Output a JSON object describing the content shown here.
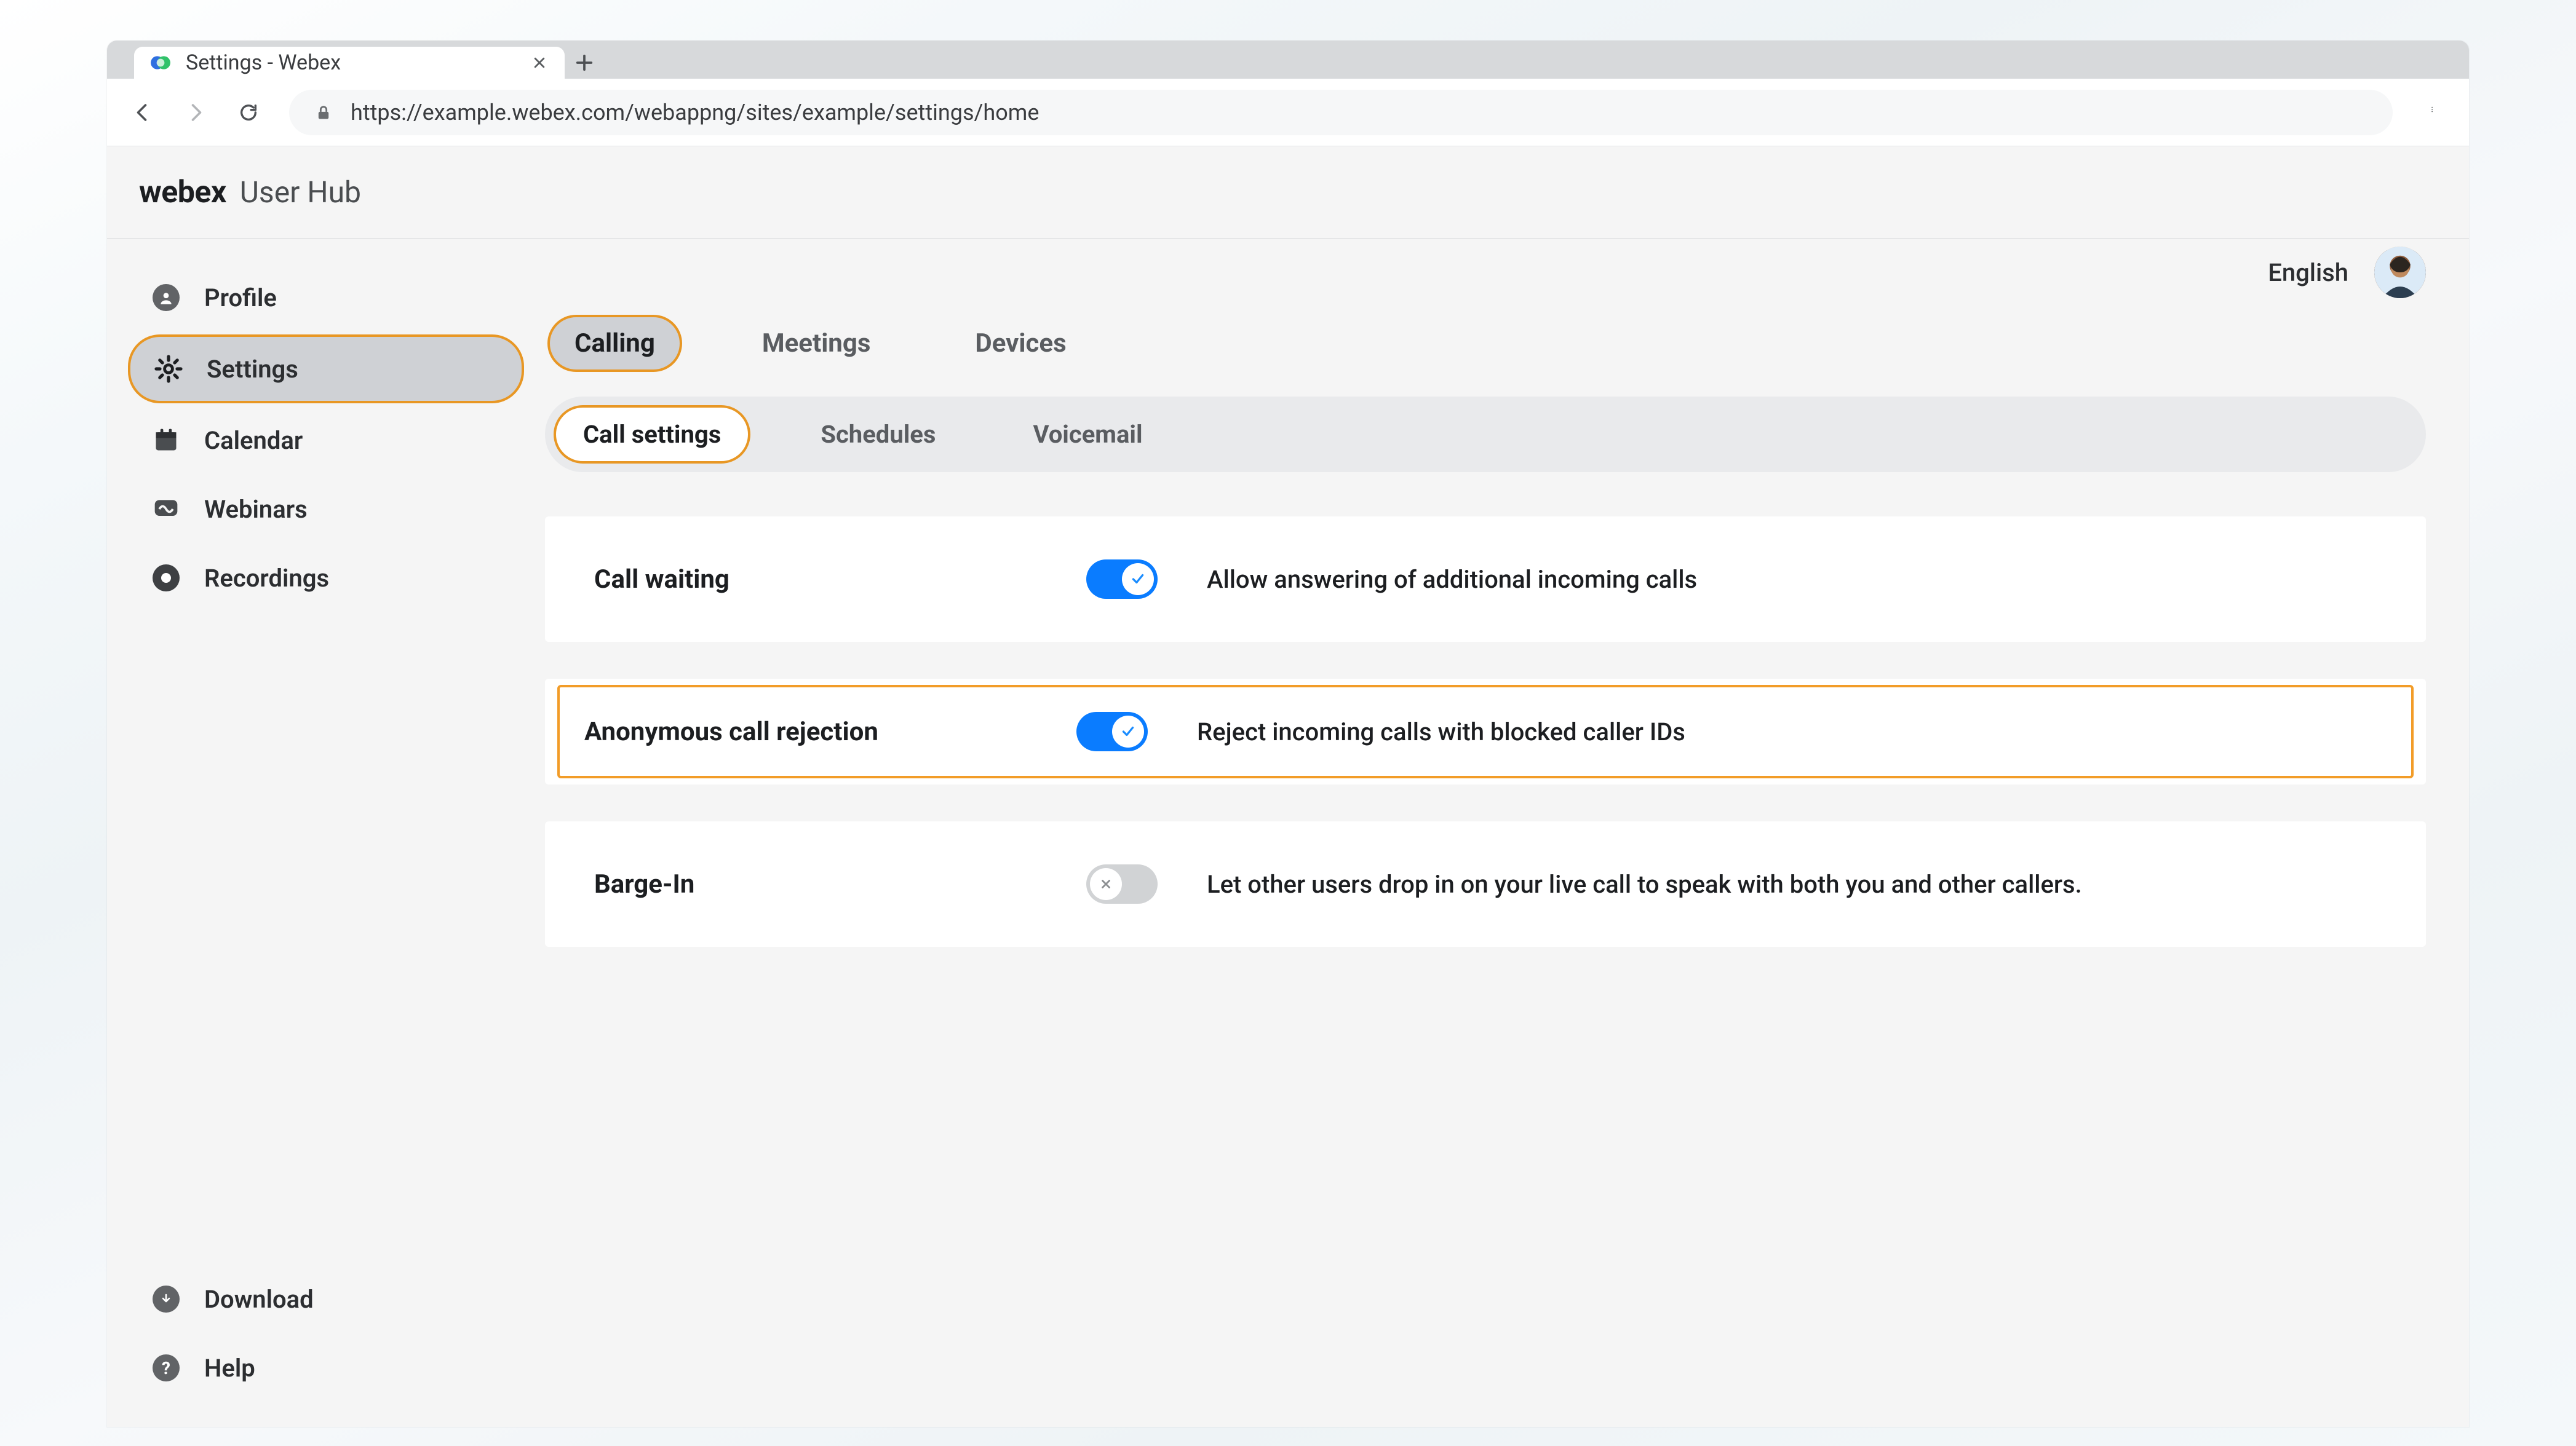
{
  "browser": {
    "tab_title": "Settings - Webex",
    "url": "https://example.webex.com/webappng/sites/example/settings/home"
  },
  "header": {
    "brand": "webex",
    "product": "User Hub",
    "language": "English"
  },
  "sidebar": {
    "items": [
      {
        "id": "profile",
        "label": "Profile",
        "icon": "person"
      },
      {
        "id": "settings",
        "label": "Settings",
        "icon": "gear",
        "selected": true
      },
      {
        "id": "calendar",
        "label": "Calendar",
        "icon": "calendar"
      },
      {
        "id": "webinars",
        "label": "Webinars",
        "icon": "webinar"
      },
      {
        "id": "recordings",
        "label": "Recordings",
        "icon": "record"
      }
    ],
    "bottom": [
      {
        "id": "download",
        "label": "Download",
        "icon": "download"
      },
      {
        "id": "help",
        "label": "Help",
        "icon": "question"
      }
    ]
  },
  "tabs": {
    "primary": [
      {
        "id": "calling",
        "label": "Calling",
        "active": true
      },
      {
        "id": "meetings",
        "label": "Meetings"
      },
      {
        "id": "devices",
        "label": "Devices"
      }
    ],
    "secondary": [
      {
        "id": "call-settings",
        "label": "Call settings",
        "active": true
      },
      {
        "id": "schedules",
        "label": "Schedules"
      },
      {
        "id": "voicemail",
        "label": "Voicemail"
      }
    ]
  },
  "settings": {
    "call_waiting": {
      "title": "Call waiting",
      "on": true,
      "desc": "Allow answering of additional incoming calls"
    },
    "anon_reject": {
      "title": "Anonymous call rejection",
      "on": true,
      "desc": "Reject incoming calls with blocked caller IDs"
    },
    "barge_in": {
      "title": "Barge-In",
      "on": false,
      "desc": "Let other users drop in on your live call to speak with both you and other callers."
    }
  }
}
